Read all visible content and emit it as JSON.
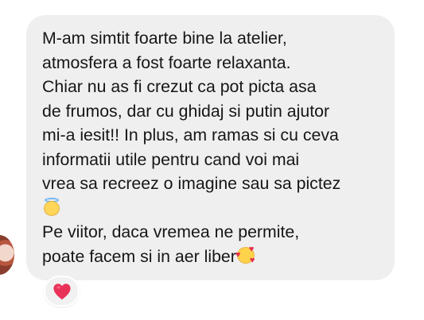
{
  "conversation": {
    "message": {
      "lines": [
        "M-am simtit foarte bine la atelier,",
        "atmosfera a fost foarte relaxanta.",
        "Chiar nu as fi crezut ca pot picta asa",
        "de frumos, dar cu ghidaj si putin ajutor",
        "mi-a iesit!! In plus, am ramas si cu ceva",
        "informatii utile pentru cand voi mai",
        "vrea sa recreez o imagine sau sa pictez",
        "",
        "Pe viitor, daca vremea ne permite,",
        "poate facem si in aer liber"
      ],
      "emojis": [
        "smiling-face-with-halo-emoji",
        "smiling-face-with-hearts-emoji"
      ]
    },
    "reaction": {
      "icon": "red-heart-icon",
      "color": "#ea3259"
    }
  },
  "colors": {
    "bubble": "#efefef",
    "text": "#161616",
    "background": "#ffffff"
  }
}
